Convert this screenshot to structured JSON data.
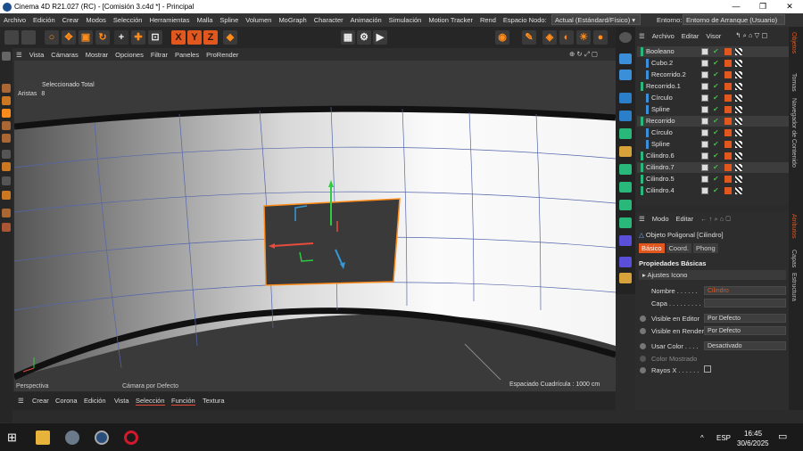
{
  "window": {
    "title": "Cinema 4D R21.027 (RC) - [Comisión 3.c4d *] - Principal"
  },
  "menu": [
    "Archivo",
    "Edición",
    "Crear",
    "Modos",
    "Selección",
    "Herramientas",
    "Malla",
    "Spline",
    "Volumen",
    "MoGraph",
    "Character",
    "Animación",
    "Simulación",
    "Motion Tracker",
    "Rend"
  ],
  "node_space": {
    "label": "Espacio Nodo:",
    "value": "Actual (Estándard/Físico)"
  },
  "environment": {
    "label": "Entorno:",
    "value": "Entorno de Arranque (Usuario)"
  },
  "toolbar": {
    "xyz": [
      "X",
      "Y",
      "Z"
    ]
  },
  "viewport_menu": [
    "Vista",
    "Cámaras",
    "Mostrar",
    "Opciones",
    "Filtrar",
    "Paneles",
    "ProRender"
  ],
  "viewport": {
    "info_title": "Seleccionado Total",
    "info_label": "Aristas",
    "info_value": "8",
    "perspective": "Perspectiva",
    "camera": "Cámara por Defecto",
    "grid": "Espaciado Cuadrícula : 1000 cm"
  },
  "bottom_menu": [
    "Crear",
    "Corona",
    "Edición",
    "Vista",
    "Selección",
    "Función",
    "Textura"
  ],
  "object_manager": {
    "menu": [
      "Archivo",
      "Editar",
      "Visor"
    ],
    "objects": [
      {
        "name": "Booleano",
        "indent": 0,
        "selected": true
      },
      {
        "name": "Cubo.2",
        "indent": 1,
        "selected": false
      },
      {
        "name": "Recorrido.2",
        "indent": 1,
        "selected": false
      },
      {
        "name": "Recorrido.1",
        "indent": 0,
        "selected": false
      },
      {
        "name": "Círculo",
        "indent": 1,
        "selected": false
      },
      {
        "name": "Spline",
        "indent": 1,
        "selected": false
      },
      {
        "name": "Recorrido",
        "indent": 0,
        "selected": true
      },
      {
        "name": "Círculo",
        "indent": 1,
        "selected": false
      },
      {
        "name": "Spline",
        "indent": 1,
        "selected": false
      },
      {
        "name": "Cilindro.6",
        "indent": 0,
        "selected": false
      },
      {
        "name": "Cilindro.7",
        "indent": 0,
        "selected": true
      },
      {
        "name": "Cilindro.5",
        "indent": 0,
        "selected": false
      },
      {
        "name": "Cilindro.4",
        "indent": 0,
        "selected": false
      }
    ]
  },
  "attributes": {
    "menu": [
      "Modo",
      "Editar"
    ],
    "object_type": "Objeto Poligonal [Cilindro]",
    "tabs": [
      "Básico",
      "Coord.",
      "Phong"
    ],
    "section": "Propiedades Básicas",
    "subsection": "Ajustes Icono",
    "name_label": "Nombre . . . . . .",
    "name_value": "Cilindro",
    "layer_label": "Capa . . . . . . . . .",
    "visible_editor_label": "Visible en Editor",
    "visible_editor_value": "Por Defecto",
    "visible_render_label": "Visible en Render",
    "visible_render_value": "Por Defecto",
    "use_color_label": "Usar Color . . . .",
    "use_color_value": "Desactivado",
    "color_display_label": "Color Mostrado",
    "xray_label": "Rayos X . . . . . ."
  },
  "side_tabs": [
    "Objetos",
    "Tomas",
    "Navegador de Contenido",
    "Atributos",
    "Capas",
    "Estructura"
  ],
  "taskbar": {
    "lang": "ESP",
    "time": "16:45",
    "date": "30/6/2025"
  },
  "colors": {
    "accent": "#ff8c1a",
    "selection": "#ff8c1a"
  }
}
